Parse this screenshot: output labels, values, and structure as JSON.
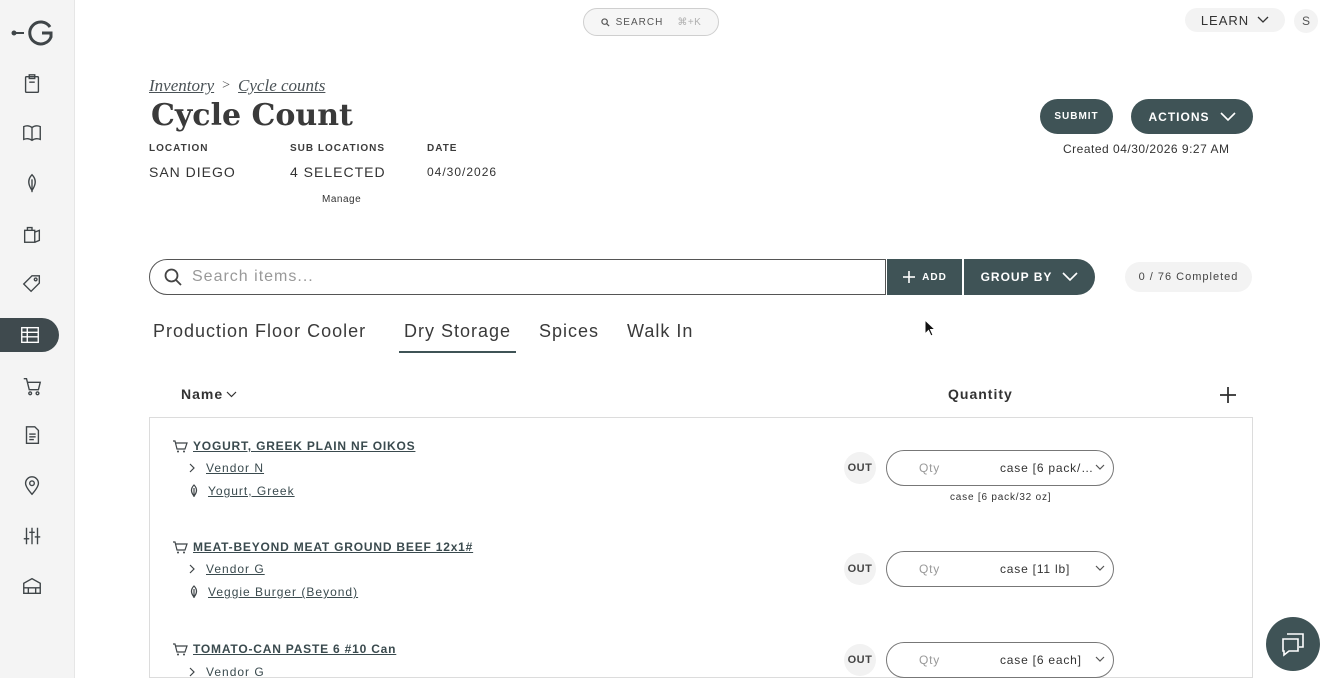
{
  "topbar": {
    "search_label": "SEARCH",
    "search_shortcut": "⌘+K",
    "learn_label": "LEARN",
    "avatar_initial": "S"
  },
  "sidebar": {
    "items": [
      {
        "icon": "clipboard-icon"
      },
      {
        "icon": "book-icon"
      },
      {
        "icon": "leaf-icon"
      },
      {
        "icon": "bag-icon"
      },
      {
        "icon": "tag-icon"
      },
      {
        "icon": "inventory-icon",
        "active": true
      },
      {
        "icon": "cart-icon"
      },
      {
        "icon": "document-icon"
      },
      {
        "icon": "location-icon"
      },
      {
        "icon": "sliders-icon"
      },
      {
        "icon": "warehouse-icon"
      }
    ]
  },
  "header": {
    "breadcrumb": [
      "Inventory",
      ">",
      "Cycle counts"
    ],
    "title": "Cycle Count",
    "location_label": "LOCATION",
    "location_value": "SAN DIEGO",
    "sublocations_label": "SUB LOCATIONS",
    "sublocations_value": "4 SELECTED",
    "manage_label": "Manage",
    "date_label": "DATE",
    "date_value": "04/30/2026",
    "submit_label": "SUBMIT",
    "actions_label": "ACTIONS",
    "created_text": "Created 04/30/2026 9:27 AM"
  },
  "toolbar": {
    "search_placeholder": "Search items...",
    "add_label": "ADD",
    "group_by_label": "GROUP BY",
    "completed_text": "0 / 76 Completed"
  },
  "tabs": [
    {
      "label": "Production Floor Cooler",
      "active": false
    },
    {
      "label": "Dry Storage",
      "active": true
    },
    {
      "label": "Spices",
      "active": false
    },
    {
      "label": "Walk In",
      "active": false
    }
  ],
  "table": {
    "col_name": "Name",
    "col_quantity": "Quantity",
    "rows": [
      {
        "name": "YOGURT, GREEK PLAIN NF OIKOS",
        "vendor": "Vendor N",
        "ingredient": "Yogurt, Greek",
        "status": "OUT",
        "qty_placeholder": "Qty",
        "unit": "case [6 pack/32 oz]",
        "unit_note": "case [6 pack/32 oz]"
      },
      {
        "name": "MEAT-BEYOND MEAT GROUND BEEF 12x1#",
        "vendor": "Vendor G",
        "ingredient": "Veggie Burger (Beyond)",
        "status": "OUT",
        "qty_placeholder": "Qty",
        "unit": "case [11 lb]",
        "unit_note": ""
      },
      {
        "name": "TOMATO-CAN PASTE 6 #10 Can",
        "vendor": "Vendor G",
        "ingredient": "",
        "status": "OUT",
        "qty_placeholder": "Qty",
        "unit": "case [6 each]",
        "unit_note": ""
      }
    ]
  },
  "colors": {
    "accent": "#3f5356",
    "sidebar_bg": "#f4f4f4",
    "active_nav": "#3f4a4e"
  }
}
